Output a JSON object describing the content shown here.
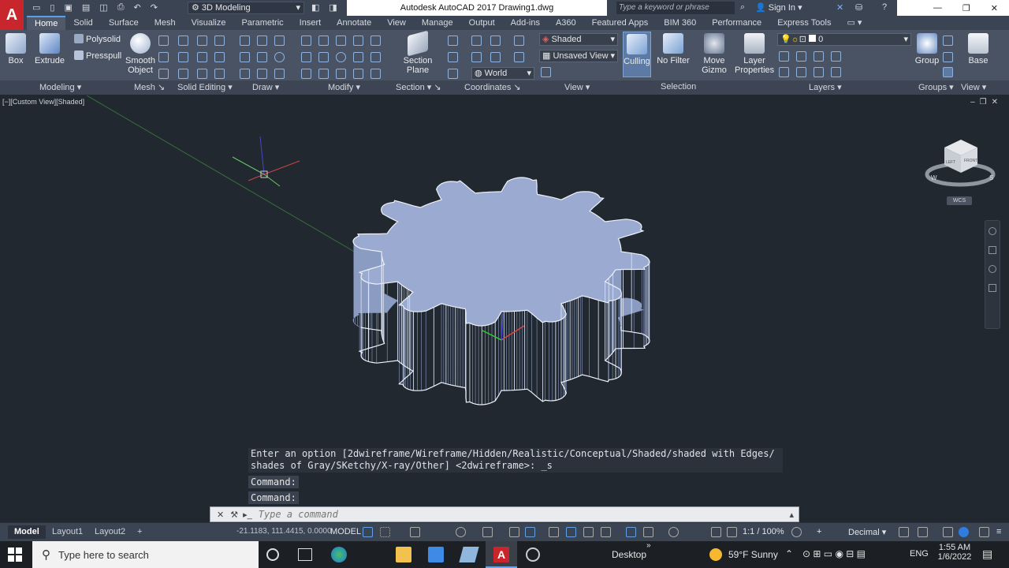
{
  "title_bar": {
    "workspace": "3D Modeling",
    "title": "Autodesk AutoCAD 2017    Drawing1.dwg",
    "search_placeholder": "Type a keyword or phrase",
    "sign_in": "Sign In"
  },
  "ribbon_tabs": [
    "Home",
    "Solid",
    "Surface",
    "Mesh",
    "Visualize",
    "Parametric",
    "Insert",
    "Annotate",
    "View",
    "Manage",
    "Output",
    "Add-ins",
    "A360",
    "Featured Apps",
    "BIM 360",
    "Performance",
    "Express Tools"
  ],
  "ribbon": {
    "box": "Box",
    "extrude": "Extrude",
    "polysolid": "Polysolid",
    "presspull": "Presspull",
    "smooth_object": "Smooth Object",
    "section_plane": "Section Plane",
    "visual_style": "Shaded",
    "saved_view": "Unsaved View",
    "ucs": "World",
    "culling": "Culling",
    "no_filter": "No Filter",
    "move_gizmo": "Move Gizmo",
    "layer_properties": "Layer Properties",
    "layer_current": "0",
    "group": "Group",
    "base": "Base",
    "panels": [
      "Modeling",
      "Mesh",
      "Solid Editing",
      "Draw",
      "Modify",
      "Section",
      "Coordinates",
      "View",
      "Selection",
      "Layers",
      "Groups",
      "View"
    ]
  },
  "viewport": {
    "label": "[−][Custom View][Shaded]",
    "wcs": "WCS",
    "cube_compass_letters": [
      "W",
      "S"
    ],
    "cube_faces": [
      "LEFT",
      "FRONT"
    ]
  },
  "command": {
    "history_line1": "Enter an option [2dwireframe/Wireframe/Hidden/Realistic/Conceptual/Shaded/shaded with Edges/",
    "history_line2": "shades of Gray/SKetchy/X-ray/Other] <2dwireframe>: _s",
    "prompt1": "Command:",
    "prompt2": "Command:",
    "placeholder": "Type a command"
  },
  "status": {
    "tabs": [
      "Model",
      "Layout1",
      "Layout2"
    ],
    "coords": "-21.1183, 111.4415, 0.0000",
    "model": "MODEL",
    "scale": "1:1 / 100%",
    "units": "Decimal"
  },
  "taskbar": {
    "search_placeholder": "Type here to search",
    "desktop": "Desktop",
    "weather": "59°F  Sunny",
    "lang": "ENG",
    "time": "1:55 AM",
    "date": "1/6/2022"
  },
  "colors": {
    "gear_fill": "#98a8cc",
    "gear_edge": "#eef2fa",
    "viewport_bg": "#212830",
    "ribbon_bg": "#4a5363"
  }
}
